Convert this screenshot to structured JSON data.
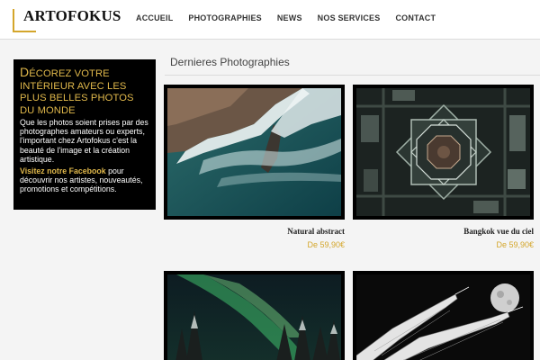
{
  "brand": {
    "logo_text": "ARTOFOKUS"
  },
  "nav": [
    {
      "label": "ACCUEIL"
    },
    {
      "label": "PHOTOGRAPHIES"
    },
    {
      "label": "NEWS"
    },
    {
      "label": "NOS SERVICES"
    },
    {
      "label": "CONTACT"
    }
  ],
  "promo": {
    "title": "Décorez votre intérieur avec les plus belles photos du monde",
    "text": "Que les photos soient prises par des photographes amateurs ou experts, l'important chez Artofokus c'est la beauté de l'image et la création artistique.",
    "link": "Visitez notre Facebook",
    "cta_rest": " pour découvrir nos artistes, nouveautés, promotions et compétitions."
  },
  "section": {
    "title": "Dernieres Photographies"
  },
  "products": [
    {
      "title": "Natural abstract",
      "price": "De 59,90€"
    },
    {
      "title": "Bangkok vue du ciel",
      "price": "De 59,90€"
    },
    {
      "title": "",
      "price": ""
    },
    {
      "title": "",
      "price": ""
    }
  ],
  "colors": {
    "accent": "#d4a62b",
    "promo_bg": "#000000",
    "header_bg": "#ffffff",
    "page_bg": "#f4f4f4"
  }
}
